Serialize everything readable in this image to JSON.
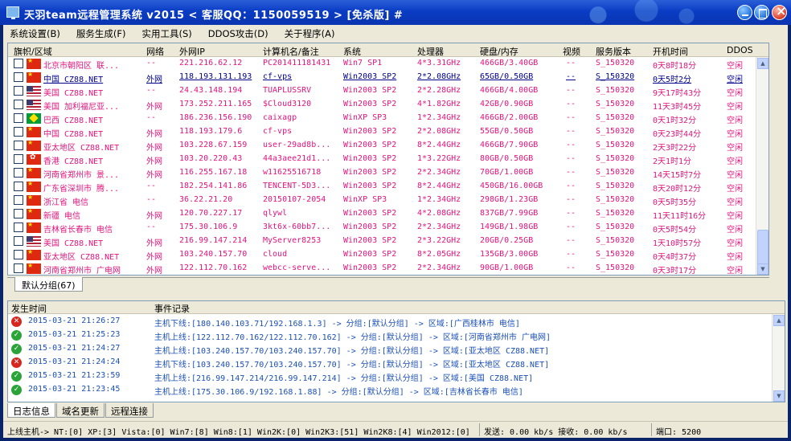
{
  "window": {
    "title": "天羽team远程管理系统 v2015  < 客服QQ：1150059519 >  [免杀版]  #"
  },
  "menu": [
    "系统设置(B)",
    "服务生成(F)",
    "实用工具(S)",
    "DDOS攻击(D)",
    "关于程序(A)"
  ],
  "host_table": {
    "columns": [
      "旗帜/区域",
      "网络",
      "外网IP",
      "计算机名/备注",
      "系统",
      "处理器",
      "硬盘/内存",
      "视频",
      "服务版本",
      "开机时间",
      "DDOS"
    ],
    "rows": [
      {
        "flag": "cn",
        "region": "北京市朝阳区 联...",
        "net": "--",
        "ip": "221.216.62.12",
        "name": "PC201411181431",
        "os": "Win7 SP1",
        "cpu": "4*3.31GHz",
        "disk": "466GB/3.40GB",
        "video": "--",
        "ver": "S_150320",
        "uptime": "0天8时18分",
        "ddos": "空闲"
      },
      {
        "flag": "cn",
        "region": "中国  CZ88.NET",
        "net": "外网",
        "ip": "118.193.131.193",
        "name": "cf-vps",
        "os": "Win2003 SP2",
        "cpu": "2*2.08GHz",
        "disk": "65GB/0.50GB",
        "video": "--",
        "ver": "S_150320",
        "uptime": "0天5时2分",
        "ddos": "空闲",
        "selected": true
      },
      {
        "flag": "us",
        "region": "美国  CZ88.NET",
        "net": "--",
        "ip": "24.43.148.194",
        "name": "TUAPLUSSRV",
        "os": "Win2003 SP2",
        "cpu": "2*2.28GHz",
        "disk": "466GB/4.00GB",
        "video": "--",
        "ver": "S_150320",
        "uptime": "9天17时43分",
        "ddos": "空闲"
      },
      {
        "flag": "us",
        "region": "美国 加利福尼亚...",
        "net": "外网",
        "ip": "173.252.211.165",
        "name": "$Cloud3120",
        "os": "Win2003 SP2",
        "cpu": "4*1.82GHz",
        "disk": "42GB/0.90GB",
        "video": "--",
        "ver": "S_150320",
        "uptime": "11天3时45分",
        "ddos": "空闲"
      },
      {
        "flag": "br",
        "region": "巴西  CZ88.NET",
        "net": "--",
        "ip": "186.236.156.190",
        "name": "caixagp",
        "os": "WinXP SP3",
        "cpu": "1*2.34GHz",
        "disk": "466GB/2.00GB",
        "video": "--",
        "ver": "S_150320",
        "uptime": "0天1时32分",
        "ddos": "空闲"
      },
      {
        "flag": "cn",
        "region": "中国  CZ88.NET",
        "net": "外网",
        "ip": "118.193.179.6",
        "name": "cf-vps",
        "os": "Win2003 SP2",
        "cpu": "2*2.08GHz",
        "disk": "55GB/0.50GB",
        "video": "--",
        "ver": "S_150320",
        "uptime": "0天23时44分",
        "ddos": "空闲"
      },
      {
        "flag": "cn",
        "region": "亚太地区  CZ88.NET",
        "net": "外网",
        "ip": "103.228.67.159",
        "name": "user-29ad8b...",
        "os": "Win2003 SP2",
        "cpu": "8*2.44GHz",
        "disk": "466GB/7.90GB",
        "video": "--",
        "ver": "S_150320",
        "uptime": "2天3时22分",
        "ddos": "空闲"
      },
      {
        "flag": "hk",
        "region": "香港  CZ88.NET",
        "net": "外网",
        "ip": "103.20.220.43",
        "name": "44a3aee21d1...",
        "os": "Win2003 SP2",
        "cpu": "1*3.22GHz",
        "disk": "80GB/0.50GB",
        "video": "--",
        "ver": "S_150320",
        "uptime": "2天1时1分",
        "ddos": "空闲"
      },
      {
        "flag": "cn",
        "region": "河南省郑州市 景...",
        "net": "外网",
        "ip": "116.255.167.18",
        "name": "w11625516718",
        "os": "Win2003 SP2",
        "cpu": "2*2.34GHz",
        "disk": "70GB/1.00GB",
        "video": "--",
        "ver": "S_150320",
        "uptime": "14天15时7分",
        "ddos": "空闲"
      },
      {
        "flag": "cn",
        "region": "广东省深圳市 腾...",
        "net": "--",
        "ip": "182.254.141.86",
        "name": "TENCENT-5D3...",
        "os": "Win2003 SP2",
        "cpu": "8*2.44GHz",
        "disk": "450GB/16.00GB",
        "video": "--",
        "ver": "S_150320",
        "uptime": "8天20时12分",
        "ddos": "空闲"
      },
      {
        "flag": "cn",
        "region": "浙江省 电信",
        "net": "--",
        "ip": "36.22.21.20",
        "name": "20150107-2054",
        "os": "WinXP SP3",
        "cpu": "1*2.34GHz",
        "disk": "298GB/1.23GB",
        "video": "--",
        "ver": "S_150320",
        "uptime": "0天5时35分",
        "ddos": "空闲"
      },
      {
        "flag": "cn",
        "region": "新疆 电信",
        "net": "外网",
        "ip": "120.70.227.17",
        "name": "qlywl",
        "os": "Win2003 SP2",
        "cpu": "4*2.08GHz",
        "disk": "837GB/7.99GB",
        "video": "--",
        "ver": "S_150320",
        "uptime": "11天11时16分",
        "ddos": "空闲"
      },
      {
        "flag": "cn",
        "region": "吉林省长春市 电信",
        "net": "--",
        "ip": "175.30.106.9",
        "name": "3kt6x-60bb7...",
        "os": "Win2003 SP2",
        "cpu": "2*2.34GHz",
        "disk": "149GB/1.98GB",
        "video": "--",
        "ver": "S_150320",
        "uptime": "0天5时54分",
        "ddos": "空闲"
      },
      {
        "flag": "us",
        "region": "美国  CZ88.NET",
        "net": "外网",
        "ip": "216.99.147.214",
        "name": "MyServer8253",
        "os": "Win2003 SP2",
        "cpu": "2*3.22GHz",
        "disk": "20GB/0.25GB",
        "video": "--",
        "ver": "S_150320",
        "uptime": "1天10时57分",
        "ddos": "空闲"
      },
      {
        "flag": "cn",
        "region": "亚太地区  CZ88.NET",
        "net": "外网",
        "ip": "103.240.157.70",
        "name": "cloud",
        "os": "Win2003 SP2",
        "cpu": "8*2.05GHz",
        "disk": "135GB/3.00GB",
        "video": "--",
        "ver": "S_150320",
        "uptime": "0天4时37分",
        "ddos": "空闲"
      },
      {
        "flag": "cn",
        "region": "河南省郑州市 广电网",
        "net": "外网",
        "ip": "122.112.70.162",
        "name": "webcc-serve...",
        "os": "Win2003 SP2",
        "cpu": "2*2.34GHz",
        "disk": "90GB/1.00GB",
        "video": "--",
        "ver": "S_150320",
        "uptime": "0天3时17分",
        "ddos": "空闲"
      }
    ]
  },
  "group_tab": "默认分组(67)",
  "log": {
    "columns": [
      "发生时间",
      "事件记录"
    ],
    "rows": [
      {
        "status": "err",
        "time": "2015-03-21 21:26:27",
        "msg": "主机下线:[180.140.103.71/192.168.1.3] -> 分组:[默认分组] -> 区域:[广西桂林市 电信]"
      },
      {
        "status": "ok",
        "time": "2015-03-21 21:25:23",
        "msg": "主机上线:[122.112.70.162/122.112.70.162] -> 分组:[默认分组] -> 区域:[河南省郑州市 广电网]"
      },
      {
        "status": "ok",
        "time": "2015-03-21 21:24:27",
        "msg": "主机上线:[103.240.157.70/103.240.157.70] -> 分组:[默认分组] -> 区域:[亚太地区  CZ88.NET]"
      },
      {
        "status": "err",
        "time": "2015-03-21 21:24:24",
        "msg": "主机下线:[103.240.157.70/103.240.157.70] -> 分组:[默认分组] -> 区域:[亚太地区  CZ88.NET]"
      },
      {
        "status": "ok",
        "time": "2015-03-21 21:23:59",
        "msg": "主机上线:[216.99.147.214/216.99.147.214] -> 分组:[默认分组] -> 区域:[美国  CZ88.NET]"
      },
      {
        "status": "ok",
        "time": "2015-03-21 21:23:45",
        "msg": "主机上线:[175.30.106.9/192.168.1.88] -> 分组:[默认分组] -> 区域:[吉林省长春市 电信]"
      }
    ]
  },
  "bottom_tabs": [
    "日志信息",
    "域名更新",
    "远程连接"
  ],
  "status": {
    "online": "上线主机-> NT:[0] XP:[3] Vista:[0] Win7:[8] Win8:[1] Win2K:[0] Win2K3:[51] Win2K8:[4] Win2012:[0]",
    "traffic": "发送: 0.00 kb/s 接收: 0.00 kb/s",
    "port": "端口: 5200"
  }
}
